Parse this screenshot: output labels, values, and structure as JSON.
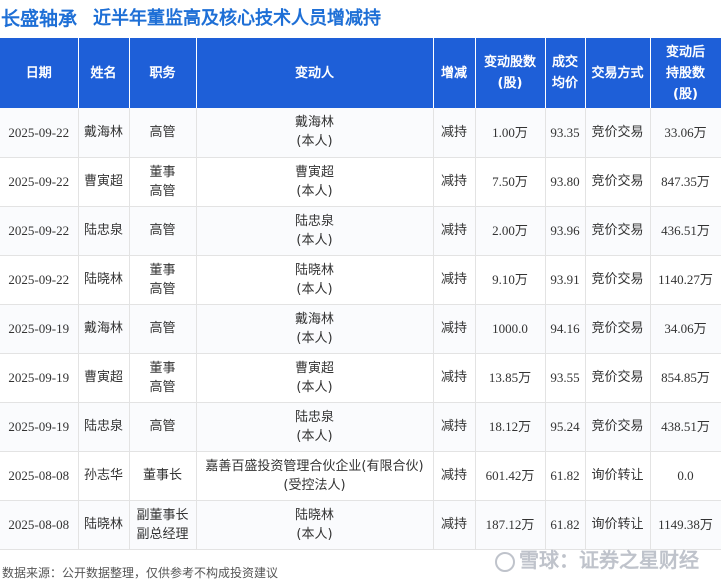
{
  "header": {
    "company": "长盛轴承",
    "subtitle": "近半年董监高及核心技术人员增减持"
  },
  "columns": [
    {
      "key": "date",
      "label": "日期"
    },
    {
      "key": "name",
      "label": "姓名"
    },
    {
      "key": "position",
      "label": "职务"
    },
    {
      "key": "changer",
      "label": "变动人"
    },
    {
      "key": "direction",
      "label": "增减"
    },
    {
      "key": "change",
      "label": "变动股数\n(股)"
    },
    {
      "key": "price",
      "label": "成交\n均价"
    },
    {
      "key": "method",
      "label": "交易方式"
    },
    {
      "key": "holding",
      "label": "变动后\n持股数\n(股)"
    }
  ],
  "rows": [
    {
      "date": "2025-09-22",
      "name": "戴海林",
      "position": "高管",
      "changer": "戴海林\n(本人)",
      "direction": "减持",
      "change": "1.00万",
      "price": "93.35",
      "method": "竞价交易",
      "holding": "33.06万"
    },
    {
      "date": "2025-09-22",
      "name": "曹寅超",
      "position": "董事\n高管",
      "changer": "曹寅超\n(本人)",
      "direction": "减持",
      "change": "7.50万",
      "price": "93.80",
      "method": "竞价交易",
      "holding": "847.35万"
    },
    {
      "date": "2025-09-22",
      "name": "陆忠泉",
      "position": "高管",
      "changer": "陆忠泉\n(本人)",
      "direction": "减持",
      "change": "2.00万",
      "price": "93.96",
      "method": "竞价交易",
      "holding": "436.51万"
    },
    {
      "date": "2025-09-22",
      "name": "陆晓林",
      "position": "董事\n高管",
      "changer": "陆晓林\n(本人)",
      "direction": "减持",
      "change": "9.10万",
      "price": "93.91",
      "method": "竞价交易",
      "holding": "1140.27万"
    },
    {
      "date": "2025-09-19",
      "name": "戴海林",
      "position": "高管",
      "changer": "戴海林\n(本人)",
      "direction": "减持",
      "change": "1000.0",
      "price": "94.16",
      "method": "竞价交易",
      "holding": "34.06万"
    },
    {
      "date": "2025-09-19",
      "name": "曹寅超",
      "position": "董事\n高管",
      "changer": "曹寅超\n(本人)",
      "direction": "减持",
      "change": "13.85万",
      "price": "93.55",
      "method": "竞价交易",
      "holding": "854.85万"
    },
    {
      "date": "2025-09-19",
      "name": "陆忠泉",
      "position": "高管",
      "changer": "陆忠泉\n(本人)",
      "direction": "减持",
      "change": "18.12万",
      "price": "95.24",
      "method": "竞价交易",
      "holding": "438.51万"
    },
    {
      "date": "2025-08-08",
      "name": "孙志华",
      "position": "董事长",
      "changer": "嘉善百盛投资管理合伙企业(有限合伙)\n(受控法人)",
      "direction": "减持",
      "change": "601.42万",
      "price": "61.82",
      "method": "询价转让",
      "holding": "0.0"
    },
    {
      "date": "2025-08-08",
      "name": "陆晓林",
      "position": "副董事长\n副总经理",
      "changer": "陆晓林\n(本人)",
      "direction": "减持",
      "change": "187.12万",
      "price": "61.82",
      "method": "询价转让",
      "holding": "1149.38万"
    }
  ],
  "footer": {
    "source": "数据来源：公开数据整理，仅供参考不构成投资建议",
    "brand": "雪球：证券之星财经"
  },
  "watermark": "证券之星",
  "colors": {
    "accent": "#1e6fd6",
    "header_bg": "#1e5fd8",
    "decrease": "#2e9e3e"
  }
}
